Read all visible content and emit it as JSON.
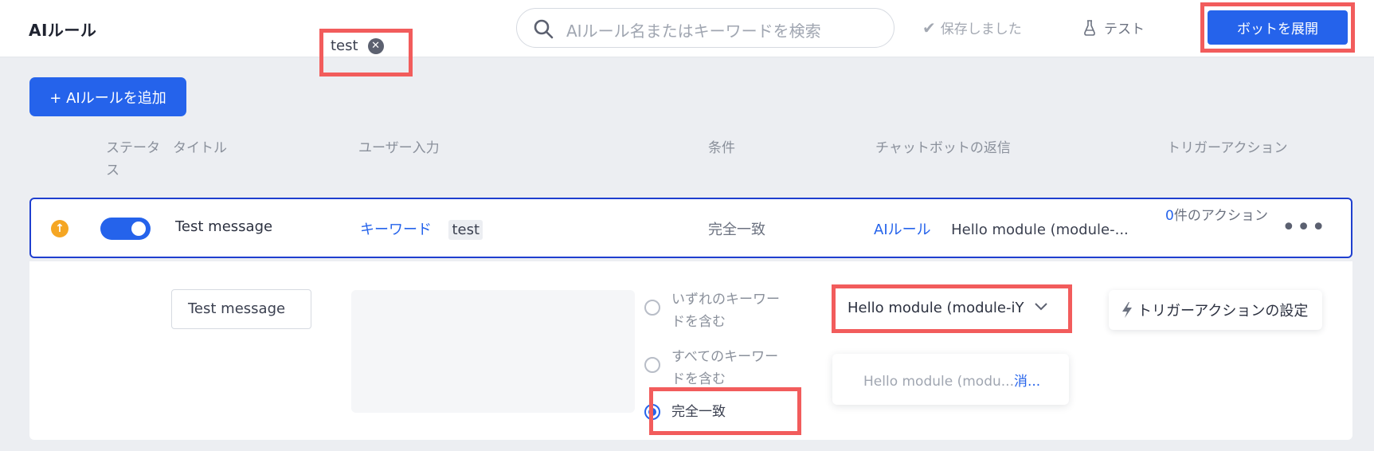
{
  "header": {
    "title": "AIルール",
    "search_placeholder": "AIルール名またはキーワードを検索",
    "saved_label": "保存しました",
    "test_label": "テスト",
    "deploy_label": "ボットを展開"
  },
  "toolbar": {
    "add_rule_label": "+ AIルールを追加"
  },
  "columns": {
    "status": "ステータス",
    "title": "タイトル",
    "user_input": "ユーザー入力",
    "condition": "条件",
    "bot_reply": "チャットボットの返信",
    "trigger_action": "トリガーアクション"
  },
  "rule": {
    "enabled": true,
    "title": "Test message",
    "input_type": "キーワード",
    "keyword": "test",
    "condition": "完全一致",
    "reply_type": "AIルール",
    "reply_text": "Hello module (module-...",
    "action_count": "0",
    "action_suffix": "件のアクション"
  },
  "editor": {
    "title_value": "Test message",
    "keyword_tag": "test",
    "match_options": [
      {
        "label": "いずれのキーワードを含む",
        "selected": false
      },
      {
        "label": "すべてのキーワードを含む",
        "selected": false
      },
      {
        "label": "完全一致",
        "selected": true
      }
    ],
    "reply_select_value": "Hello module (module-iY",
    "reply_dropdown_item": "Hello module (modu...",
    "reply_dropdown_action": "消...",
    "trigger_button_label": "トリガーアクションの設定"
  },
  "colors": {
    "accent": "#2563eb",
    "highlight": "#f25c5c",
    "warning": "#f5a623"
  }
}
